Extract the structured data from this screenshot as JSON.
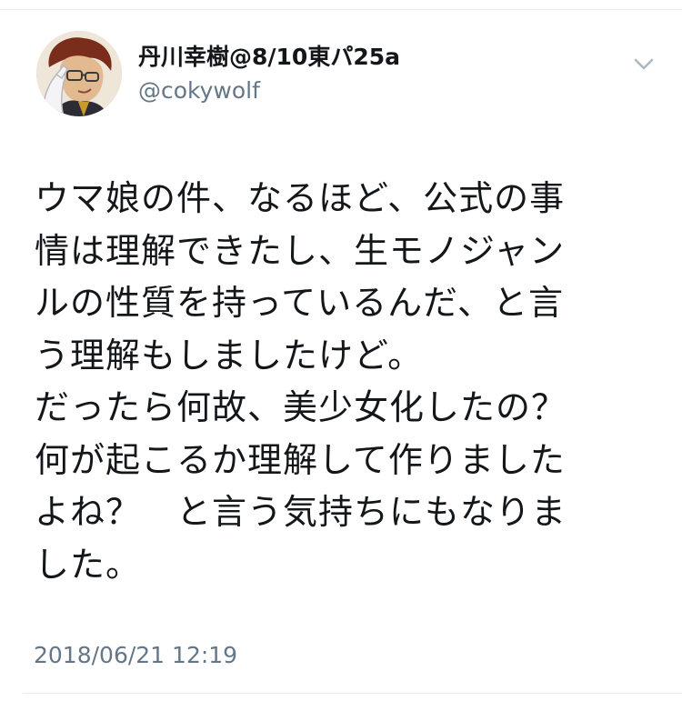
{
  "tweet": {
    "author": {
      "display_name": "丹川幸樹@8/10東パ25a",
      "handle": "@cokywolf",
      "avatar_icon": "avatar-illustration"
    },
    "menu_icon": "chevron-down-icon",
    "text_lines": [
      "ウマ娘の件、なるほど、公式の事",
      "情は理解できたし、生モノジャン",
      "ルの性質を持っているんだ、と言",
      "う理解もしましたけど。",
      "だったら何故、美少女化したの？",
      "何が起こるか理解して作りました",
      "よね？　と言う気持ちにもなりま",
      "した。"
    ],
    "timestamp": "2018/06/21 12:19"
  },
  "colors": {
    "text": "#14171a",
    "secondary": "#657786",
    "divider": "#e6ecf0",
    "chevron": "#aab8c2"
  }
}
